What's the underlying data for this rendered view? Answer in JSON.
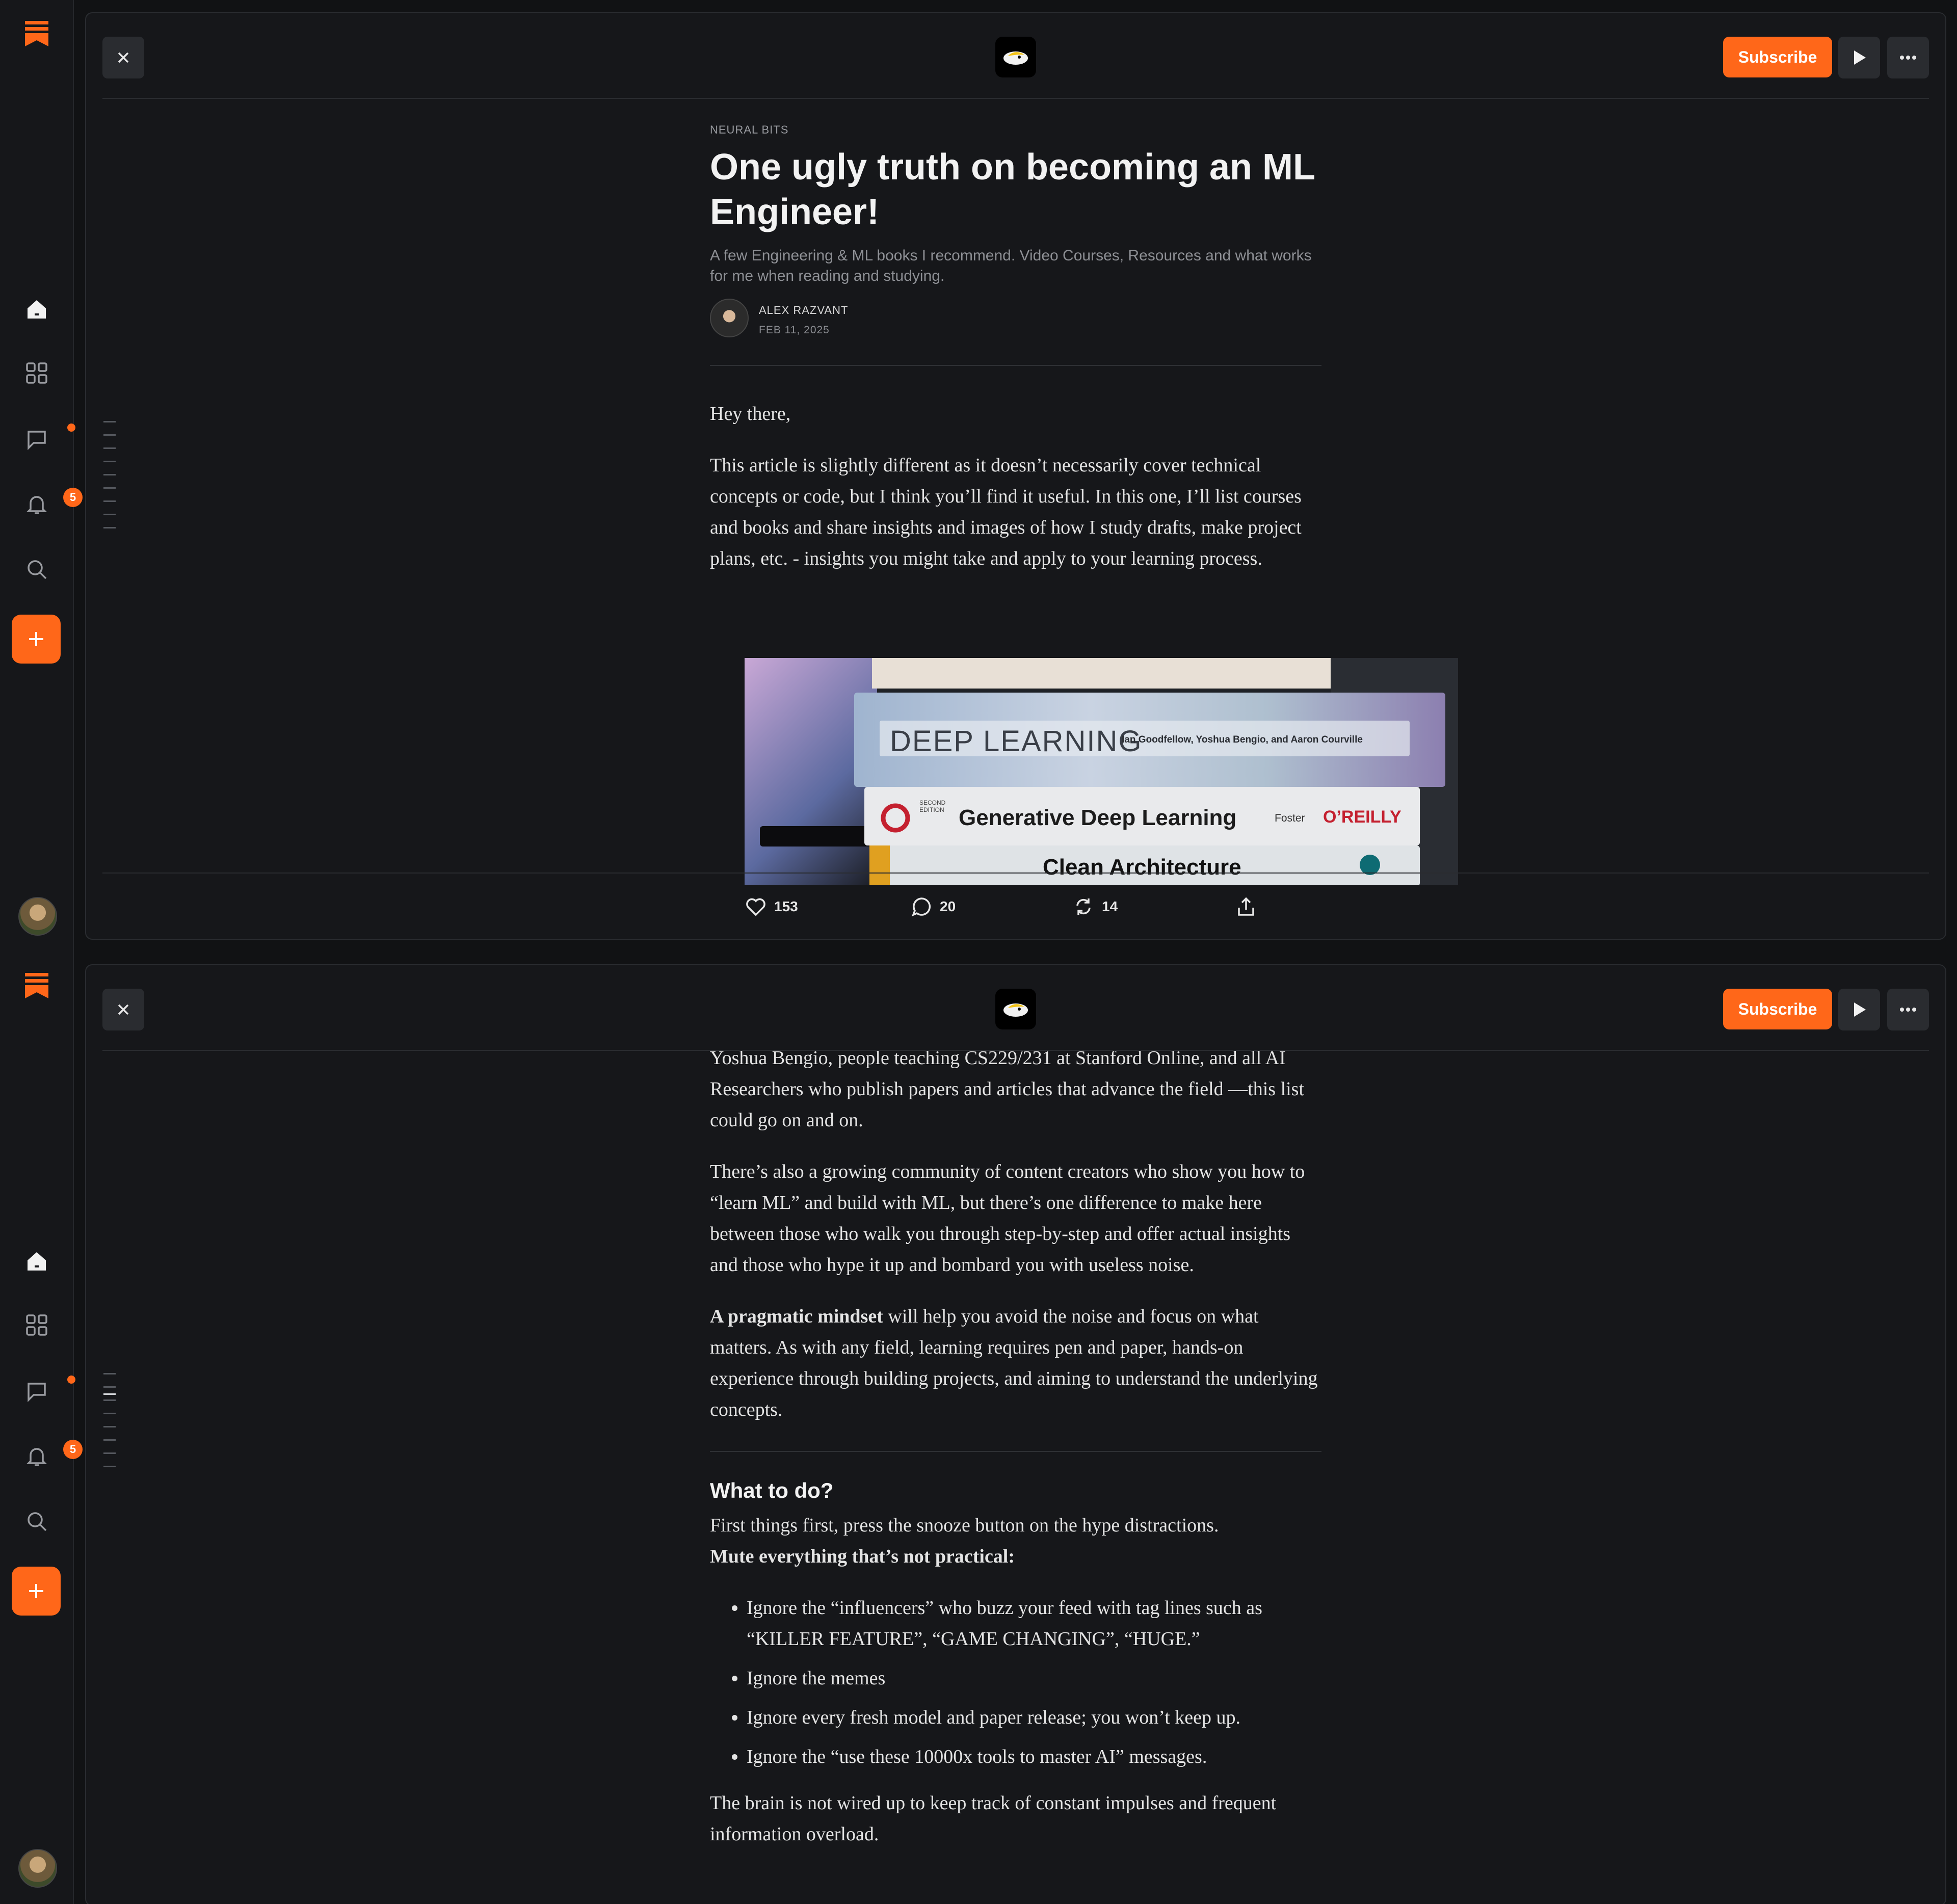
{
  "accent_color": "#ff6719",
  "icons": {
    "brand": "substack-bookmark-icon",
    "home": "home-icon",
    "explore": "grid-icon",
    "chat": "chat-icon",
    "notifications": "bell-icon",
    "search": "search-icon",
    "create": "plus-icon",
    "close": "close-icon",
    "play": "play-icon",
    "more": "more-horizontal-icon",
    "like": "heart-icon",
    "comment": "comment-icon",
    "restack": "restack-icon",
    "share": "share-icon"
  },
  "sidebar": {
    "notification_count": "5"
  },
  "topbar": {
    "subscribe_label": "Subscribe"
  },
  "article": {
    "publication": "NEURAL BITS",
    "title": "One ugly truth on becoming an ML Engineer!",
    "subtitle": "A few Engineering & ML books I recommend. Video Courses, Resources and what works for me when reading and studying.",
    "author": "ALEX RAZVANT",
    "date": "FEB 11, 2025",
    "p1": "Hey there,",
    "p2": "This article is slightly different as it doesn’t necessarily cover technical concepts or code, but I think you’ll find it useful. In this one, I’ll list courses and books and share insights and images of how I study drafts, make project plans, etc. - insights you might take and apply to your learning process.",
    "hero_books": [
      "DEEP LEARNING",
      "Ian Goodfellow, Yoshua Bengio, and Aaron Courville",
      "Generative Deep Learning",
      "SECOND EDITION",
      "Foster",
      "O’REILLY",
      "Clean Architecture"
    ]
  },
  "engagement": {
    "likes": "153",
    "comments": "20",
    "restacks": "14"
  },
  "continued": {
    "p1": "Yoshua Bengio, people teaching CS229/231 at Stanford Online, and all AI Researchers who publish papers and articles that advance the field —this list could go on and on.",
    "p2": "There’s also a growing community of content creators who show you how to “learn ML” and build with ML, but there’s one difference to make here between those who walk you through step-by-step and offer actual insights and those who hype it up and bombard you with useless noise.",
    "p3_bold": "A pragmatic mindset",
    "p3_rest": " will help you avoid the noise and focus on what matters. As with any field, learning requires pen and paper, hands-on experience through building projects, and aiming to understand the underlying concepts.",
    "heading": "What to do?",
    "p4": "First things first, press the snooze button on the hype distractions.",
    "p4_bold": "Mute everything that’s not practical:",
    "bullets": [
      "Ignore the “influencers” who buzz your feed with tag lines such as “KILLER FEATURE”, “GAME CHANGING”, “HUGE.”",
      "Ignore the memes",
      "Ignore every fresh model and paper release; you won’t keep up.",
      "Ignore the “use these 10000x tools to master AI” messages."
    ],
    "p5": "The brain is not wired up to keep track of constant impulses and frequent information overload."
  }
}
